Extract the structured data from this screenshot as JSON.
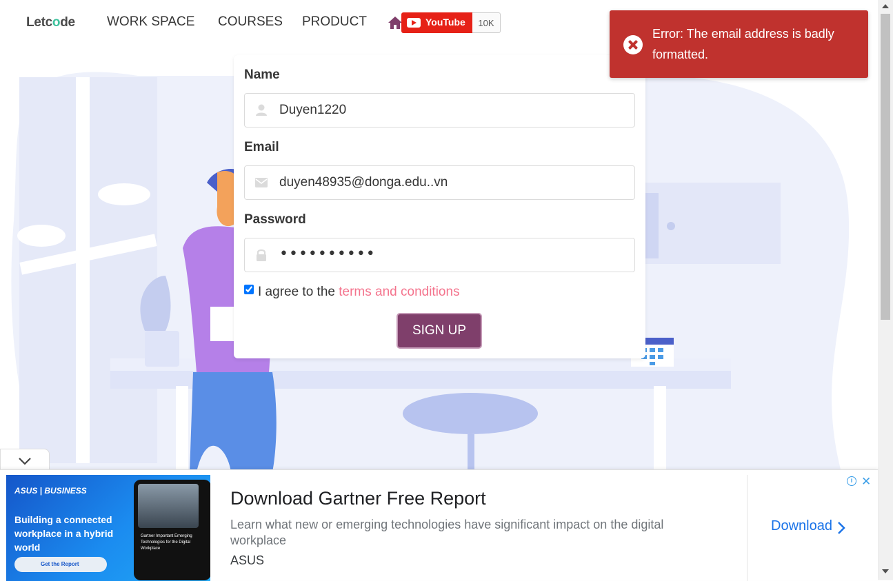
{
  "nav": {
    "logo_prefix": "Letc",
    "logo_o": "o",
    "logo_suffix": "de",
    "items": [
      "WORK SPACE",
      "COURSES",
      "PRODUCT"
    ],
    "youtube_label": "YouTube",
    "youtube_count": "10K"
  },
  "form": {
    "name_label": "Name",
    "name_value": "Duyen1220",
    "email_label": "Email",
    "email_value": "duyen48935@donga.edu..vn",
    "password_label": "Password",
    "password_value": "••••••••••",
    "agree_text": "I agree to the",
    "agree_link": "terms and conditions",
    "agree_checked": true,
    "signup_label": "SIGN UP"
  },
  "toast": {
    "message": "Error: The email address is badly formatted."
  },
  "ad": {
    "image_brand": "ASUS | BUSINESS",
    "image_headline": "Building a connected workplace in a hybrid world",
    "image_cta": "Get the Report",
    "image_phone_text": "Gartner Important Emerging Technologies for the Digital Workplace",
    "title": "Download Gartner Free Report",
    "description": "Learn what new or emerging technologies have significant impact on the digital workplace",
    "advertiser": "ASUS",
    "cta": "Download"
  },
  "colors": {
    "toast_bg": "#c0322e",
    "signup_bg": "#7f3f6b",
    "link": "#f14668",
    "ad_link": "#1a73e8"
  }
}
